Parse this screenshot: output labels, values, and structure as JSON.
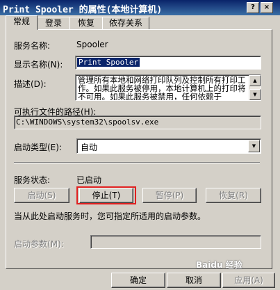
{
  "window": {
    "title": "Print Spooler 的属性(本地计算机)",
    "help_glyph": "?",
    "close_glyph": "×"
  },
  "tabs": [
    {
      "label": "常规"
    },
    {
      "label": "登录"
    },
    {
      "label": "恢复"
    },
    {
      "label": "依存关系"
    }
  ],
  "general": {
    "service_name_label": "服务名称:",
    "service_name_value": "Spooler",
    "display_name_label": "显示名称(N):",
    "display_name_value": "Print Spooler",
    "description_label": "描述(D):",
    "description_value": "管理所有本地和网络打印队列及控制所有打印工作。如果此服务被停用，本地计算机上的打印将不可用。如果此服务被禁用，任何依赖于",
    "exe_path_label": "可执行文件的路径(H):",
    "exe_path_value": "C:\\WINDOWS\\system32\\spoolsv.exe",
    "startup_type_label": "启动类型(E):",
    "startup_type_value": "自动",
    "service_status_label": "服务状态:",
    "service_status_value": "已启动",
    "start_button": "启动(S)",
    "stop_button": "停止(T)",
    "pause_button": "暂停(P)",
    "resume_button": "恢复(R)",
    "hint_text": "当从此处启动服务时，您可指定所适用的启动参数。",
    "start_params_label": "启动参数(M):",
    "start_params_value": ""
  },
  "footer": {
    "ok_button": "确定",
    "cancel_button": "取消",
    "apply_button": "应用(A)"
  },
  "watermark": {
    "text": "Baidu 经验"
  },
  "colors": {
    "title_bar": "#0a246a",
    "highlight_border": "#e02020",
    "window_bg": "#d4d0c8"
  }
}
